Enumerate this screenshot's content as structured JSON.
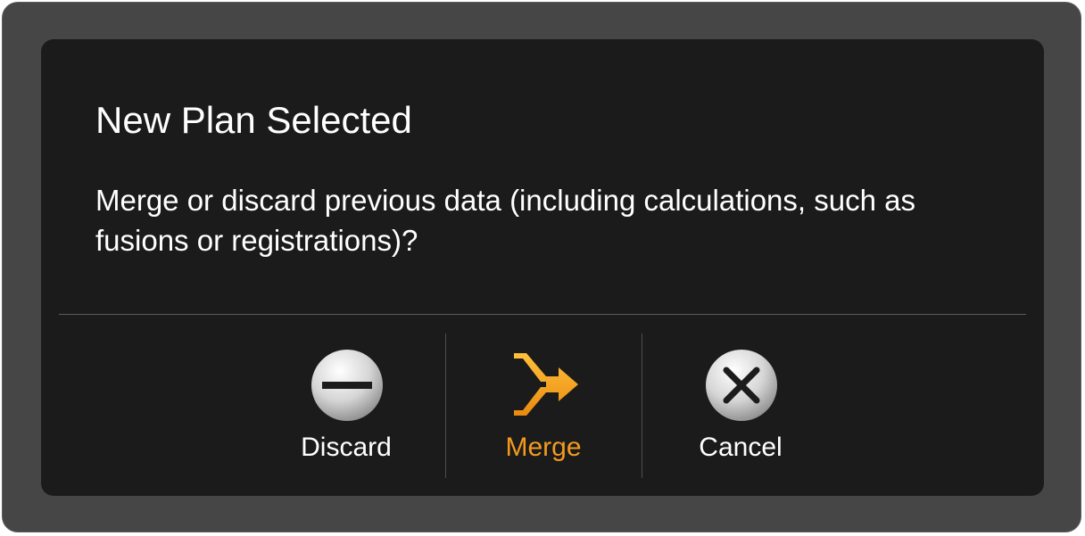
{
  "dialog": {
    "title": "New Plan Selected",
    "message": "Merge or discard previous data (including calculations, such as fusions or registrations)?"
  },
  "buttons": {
    "discard": {
      "label": "Discard",
      "icon": "minus-circle-icon"
    },
    "merge": {
      "label": "Merge",
      "icon": "merge-arrow-icon",
      "color": "#f29a1f"
    },
    "cancel": {
      "label": "Cancel",
      "icon": "x-circle-icon"
    }
  }
}
